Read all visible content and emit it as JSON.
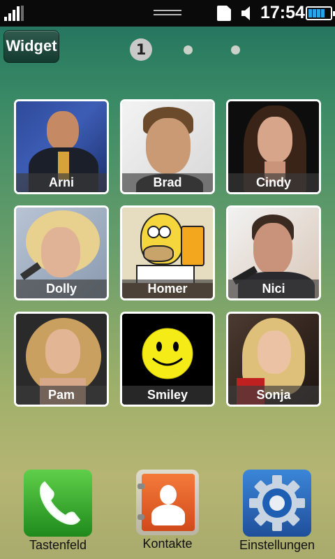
{
  "status_bar": {
    "time": "17:54",
    "icons": [
      "signal-icon",
      "sd-card-icon",
      "speaker-icon",
      "battery-icon"
    ],
    "battery_level": 0.8
  },
  "widget_button": {
    "label": "Widget"
  },
  "pager": {
    "current_page": "1",
    "total_pages": 3
  },
  "contacts": [
    {
      "name": "Arni"
    },
    {
      "name": "Brad"
    },
    {
      "name": "Cindy"
    },
    {
      "name": "Dolly"
    },
    {
      "name": "Homer"
    },
    {
      "name": "Nici"
    },
    {
      "name": "Pam"
    },
    {
      "name": "Smiley"
    },
    {
      "name": "Sonja"
    }
  ],
  "dock": [
    {
      "label": "Tastenfeld",
      "icon": "phone-icon"
    },
    {
      "label": "Kontakte",
      "icon": "contacts-icon"
    },
    {
      "label": "Einstellungen",
      "icon": "settings-gear-icon"
    }
  ],
  "colors": {
    "phone": "#2e9a2a",
    "contacts": "#e8622a",
    "settings": "#2c6fbf",
    "battery": "#2aa4e8"
  }
}
